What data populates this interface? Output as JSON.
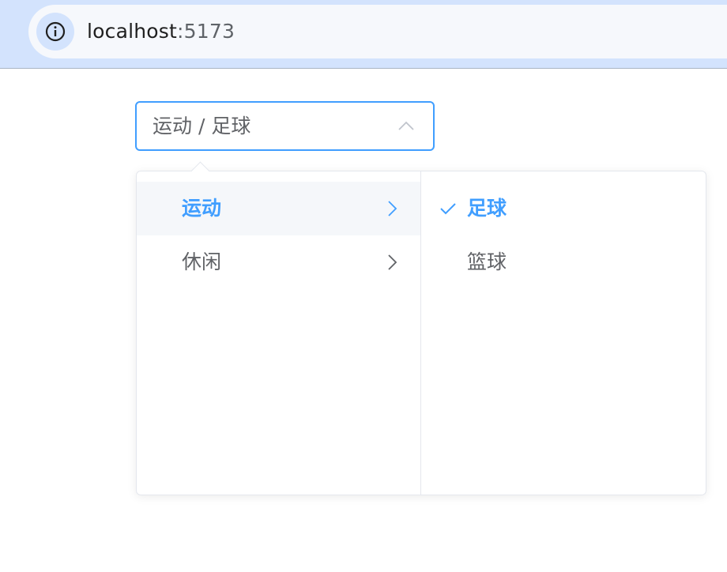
{
  "browser": {
    "url_host": "localhost",
    "url_port": ":5173",
    "info_icon": "info-icon"
  },
  "cascader": {
    "value": "运动 / 足球",
    "arrow_icon": "chevron-up-icon"
  },
  "menu_level_1": {
    "items": [
      {
        "label": "运动",
        "state": "active"
      },
      {
        "label": "休闲",
        "state": "normal"
      }
    ]
  },
  "menu_level_2": {
    "items": [
      {
        "label": "足球",
        "state": "selected"
      },
      {
        "label": "篮球",
        "state": "normal"
      }
    ]
  },
  "colors": {
    "accent": "#409eff",
    "text": "#606266",
    "border": "#e4e7ed",
    "hover_bg": "#f5f7fa",
    "browser_bar": "#d3e3fd"
  }
}
